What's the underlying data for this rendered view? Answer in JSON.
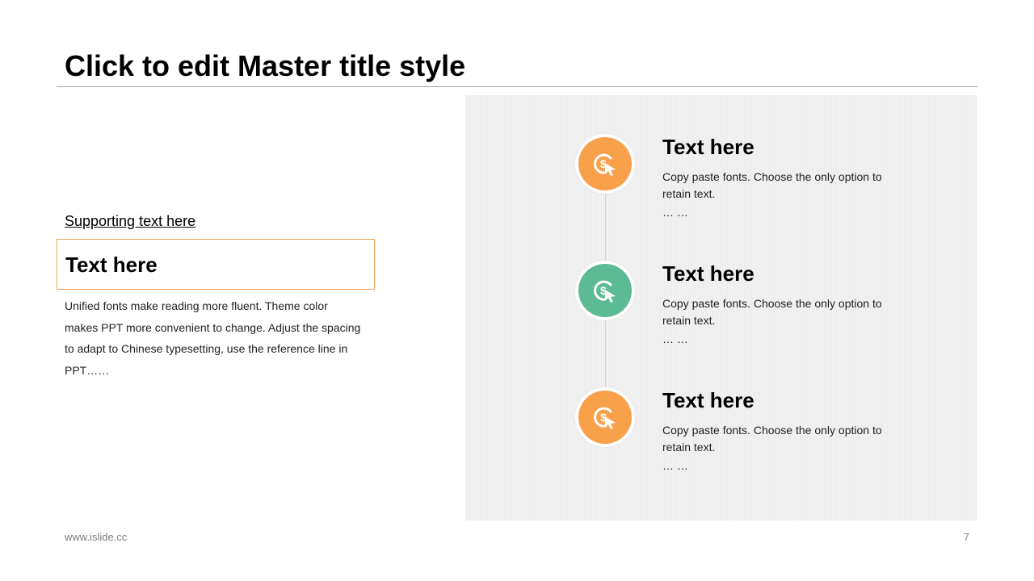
{
  "slide": {
    "title": "Click to edit Master title style",
    "page_number": "7",
    "footer_url": "www.islide.cc"
  },
  "left": {
    "supporting_text": "Supporting text here",
    "box_title": "Text here",
    "body": "Unified fonts make reading more fluent. Theme color makes PPT more convenient to change. Adjust the spacing to adapt to Chinese typesetting, use the reference line in PPT……"
  },
  "timeline": {
    "items": [
      {
        "title": "Text here",
        "description": "Copy paste fonts. Choose the only option to retain text.",
        "ellipsis": "… …",
        "icon": "dollar-click-icon",
        "color": "#f9a04b"
      },
      {
        "title": "Text here",
        "description": "Copy paste fonts. Choose the only option to retain text.",
        "ellipsis": "… …",
        "icon": "dollar-click-icon",
        "color": "#5cba95"
      },
      {
        "title": "Text here",
        "description": "Copy paste fonts. Choose the only option to retain text.",
        "ellipsis": "… …",
        "icon": "dollar-click-icon",
        "color": "#f9a04b"
      }
    ]
  },
  "colors": {
    "accent_orange": "#f9a04b",
    "accent_green": "#5cba95",
    "panel_background": "#f1f1f1",
    "box_border": "#f4a04a"
  }
}
